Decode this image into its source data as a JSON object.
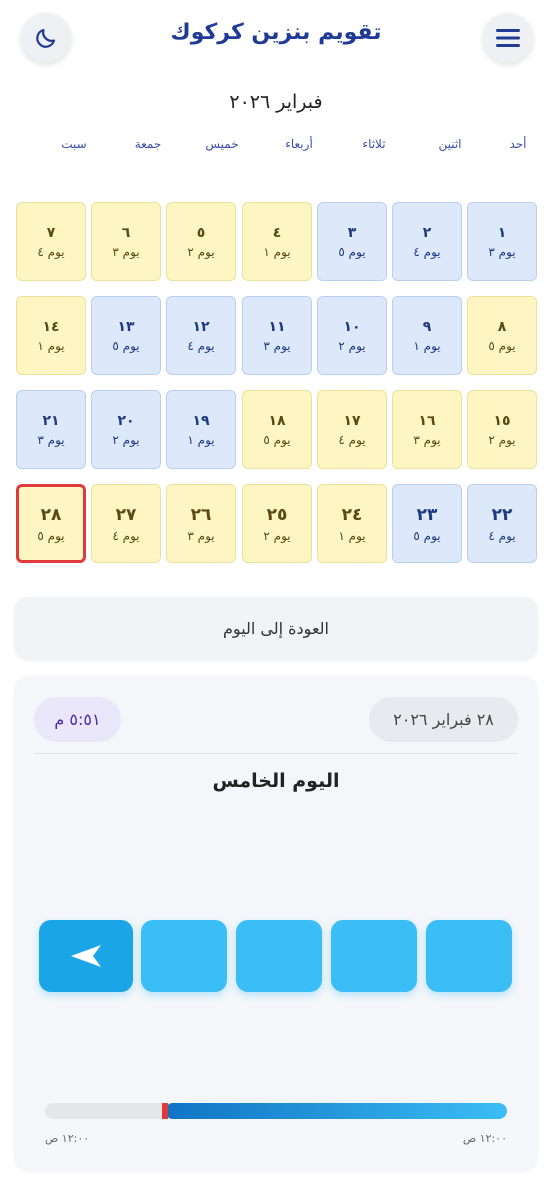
{
  "header": {
    "title": "تقويم بنزين كركوك",
    "menu_icon": "menu-icon",
    "theme_icon": "moon-icon"
  },
  "month_title": "فبراير ٢٠٢٦",
  "weekdays": [
    "أحد",
    "اثنين",
    "ثلاثاء",
    "أربعاء",
    "خميس",
    "جمعة",
    "سبت"
  ],
  "calendar": [
    [
      {
        "num": "١",
        "label": "يوم ٣",
        "color": "blue"
      },
      {
        "num": "٢",
        "label": "يوم ٤",
        "color": "blue"
      },
      {
        "num": "٣",
        "label": "يوم ٥",
        "color": "blue"
      },
      {
        "num": "٤",
        "label": "يوم ١",
        "color": "yellow"
      },
      {
        "num": "٥",
        "label": "يوم ٢",
        "color": "yellow"
      },
      {
        "num": "٦",
        "label": "يوم ٣",
        "color": "yellow"
      },
      {
        "num": "٧",
        "label": "يوم ٤",
        "color": "yellow"
      }
    ],
    [
      {
        "num": "٨",
        "label": "يوم ٥",
        "color": "yellow"
      },
      {
        "num": "٩",
        "label": "يوم ١",
        "color": "blue"
      },
      {
        "num": "١٠",
        "label": "يوم ٢",
        "color": "blue"
      },
      {
        "num": "١١",
        "label": "يوم ٣",
        "color": "blue"
      },
      {
        "num": "١٢",
        "label": "يوم ٤",
        "color": "blue"
      },
      {
        "num": "١٣",
        "label": "يوم ٥",
        "color": "blue"
      },
      {
        "num": "١٤",
        "label": "يوم ١",
        "color": "yellow"
      }
    ],
    [
      {
        "num": "١٥",
        "label": "يوم ٢",
        "color": "yellow"
      },
      {
        "num": "١٦",
        "label": "يوم ٣",
        "color": "yellow"
      },
      {
        "num": "١٧",
        "label": "يوم ٤",
        "color": "yellow"
      },
      {
        "num": "١٨",
        "label": "يوم ٥",
        "color": "yellow"
      },
      {
        "num": "١٩",
        "label": "يوم ١",
        "color": "blue"
      },
      {
        "num": "٢٠",
        "label": "يوم ٢",
        "color": "blue"
      },
      {
        "num": "٢١",
        "label": "يوم ٣",
        "color": "blue"
      }
    ],
    [
      {
        "num": "٢٢",
        "label": "يوم ٤",
        "color": "blue"
      },
      {
        "num": "٢٣",
        "label": "يوم ٥",
        "color": "blue"
      },
      {
        "num": "٢٤",
        "label": "يوم ١",
        "color": "yellow"
      },
      {
        "num": "٢٥",
        "label": "يوم ٢",
        "color": "yellow"
      },
      {
        "num": "٢٦",
        "label": "يوم ٣",
        "color": "yellow"
      },
      {
        "num": "٢٧",
        "label": "يوم ٤",
        "color": "yellow"
      },
      {
        "num": "٢٨",
        "label": "يوم ٥",
        "color": "yellow",
        "today": true
      }
    ]
  ],
  "back_today_label": "العودة إلى اليوم",
  "info": {
    "date": "٢٨ فبراير ٢٠٢٦",
    "time": "٥:٥١ م",
    "day_name": "اليوم الخامس",
    "active_slot_icon": "arrow-left-icon",
    "active_slot_index": 5,
    "slot_count": 5,
    "progress_fraction": 0.74,
    "start_label": "١٢:٠٠ ص",
    "end_label": "١٢:٠٠ ص"
  },
  "colors": {
    "accent": "#1f3b96",
    "blue_cell": "#dde9fb",
    "yellow_cell": "#fdf6c3",
    "today_border": "#e03a3a",
    "slot": "#3bbdf5",
    "slot_active": "#1aa6e6"
  }
}
